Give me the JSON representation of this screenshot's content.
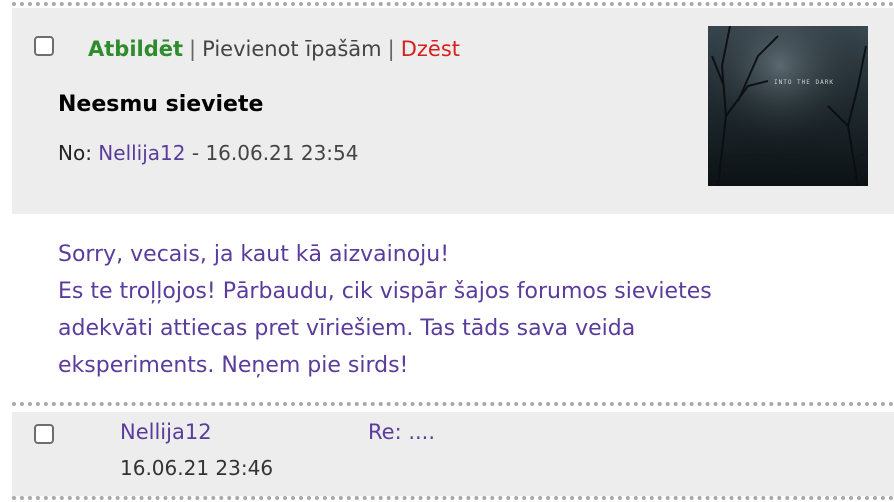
{
  "message": {
    "actions": {
      "reply_label": "Atbildēt",
      "separator": "|",
      "favorite_label": "Pievienot īpašām",
      "delete_label": "Dzēst"
    },
    "title": "Neesmu sieviete",
    "from_label": "No:",
    "author": "Nellija12",
    "date_separator": "-",
    "datetime": "16.06.21 23:54",
    "thumbnail_overlay_text": "INTO THE DARK",
    "body_lines": [
      "Sorry, vecais, ja kaut kā aizvainoju!",
      "Es te troļļojos! Pārbaudu, cik vispār šajos forumos sievietes",
      "adekvāti attiecas pret vīriešiem. Tas tāds sava veida",
      "eksperiments. Neņem pie sirds!"
    ]
  },
  "reply_list": [
    {
      "author": "Nellija12",
      "datetime": "16.06.21 23:46",
      "subject": "Re: ...."
    }
  ],
  "colors": {
    "link_purple": "#5a3c9c",
    "reply_green": "#2e8b2e",
    "delete_red": "#d62020",
    "header_bg": "#ededed"
  }
}
